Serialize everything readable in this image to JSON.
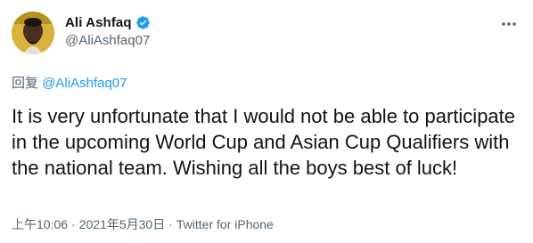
{
  "user": {
    "display_name": "Ali Ashfaq",
    "handle": "@AliAshfaq07",
    "verified": true
  },
  "reply": {
    "prefix": "回复",
    "to_handle": "@AliAshfaq07"
  },
  "tweet": {
    "text": "It is very unfortunate that I would not be able to participate in the upcoming World Cup and Asian Cup Qualifiers with the national team. Wishing all the boys best of luck!"
  },
  "meta": {
    "time": "上午10:06",
    "separator": "·",
    "date": "2021年5月30日",
    "source": "Twitter for iPhone"
  },
  "colors": {
    "verified": "#1d9bf0",
    "link": "#1d9bf0",
    "secondary_text": "#536471"
  },
  "icons": {
    "verified": "verified-badge-icon",
    "more": "more-options-icon"
  }
}
